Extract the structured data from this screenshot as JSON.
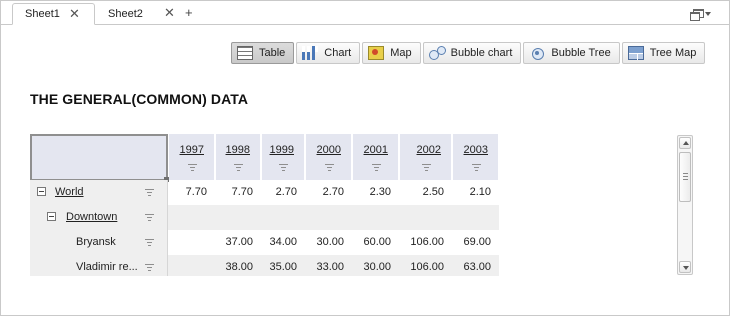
{
  "tabs": [
    {
      "label": "Sheet1",
      "active": true
    },
    {
      "label": "Sheet2",
      "active": false
    }
  ],
  "tab_close_glyph": "✕",
  "add_tab_glyph": "+",
  "view_buttons": [
    {
      "label": "Table",
      "icon": "table-icon",
      "active": true
    },
    {
      "label": "Chart",
      "icon": "bar-chart-icon",
      "active": false
    },
    {
      "label": "Map",
      "icon": "map-icon",
      "active": false
    },
    {
      "label": "Bubble chart",
      "icon": "bubble-chart-icon",
      "active": false
    },
    {
      "label": "Bubble Tree",
      "icon": "bubble-tree-icon",
      "active": false
    },
    {
      "label": "Tree Map",
      "icon": "tree-map-icon",
      "active": false
    }
  ],
  "report_title": "THE GENERAL(COMMON) DATA",
  "grid": {
    "columns": [
      "1997",
      "1998",
      "1999",
      "2000",
      "2001",
      "2002",
      "2003"
    ],
    "rows": [
      {
        "label": "World",
        "level": 0,
        "expandable": true,
        "link": true,
        "shaded": false,
        "values": [
          "7.70",
          "7.70",
          "2.70",
          "2.70",
          "2.30",
          "2.50",
          "2.10"
        ]
      },
      {
        "label": "Downtown",
        "level": 1,
        "expandable": true,
        "link": true,
        "shaded": true,
        "values": [
          "",
          "",
          "",
          "",
          "",
          "",
          ""
        ]
      },
      {
        "label": "Bryansk",
        "level": 2,
        "expandable": false,
        "link": false,
        "shaded": false,
        "values": [
          "",
          "37.00",
          "34.00",
          "30.00",
          "60.00",
          "106.00",
          "69.00"
        ]
      },
      {
        "label": "Vladimir re...",
        "level": 2,
        "expandable": false,
        "link": false,
        "shaded": true,
        "values": [
          "",
          "38.00",
          "35.00",
          "33.00",
          "30.00",
          "106.00",
          "63.00"
        ]
      }
    ]
  },
  "colors": {
    "header_bg": "#e4e6f0",
    "row_shade": "#efefef",
    "border": "#c9c9c9"
  }
}
